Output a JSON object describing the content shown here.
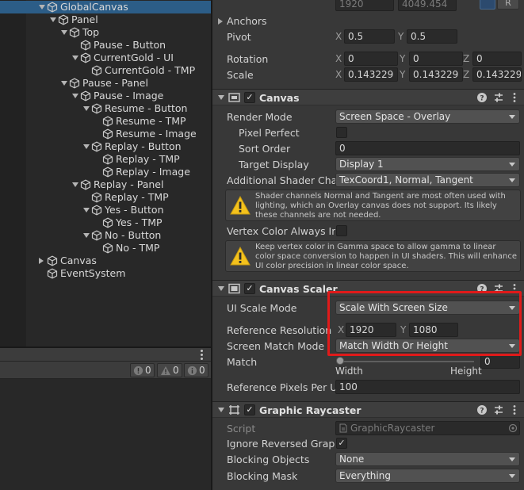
{
  "hierarchy": {
    "items": [
      {
        "label": "GlobalCanvas",
        "depth": 0,
        "expanded": true,
        "selected": true
      },
      {
        "label": "Panel",
        "depth": 1,
        "expanded": true
      },
      {
        "label": "Top",
        "depth": 2,
        "expanded": true
      },
      {
        "label": "Pause - Button",
        "depth": 3
      },
      {
        "label": "CurrentGold - UI",
        "depth": 3,
        "expanded": true
      },
      {
        "label": "CurrentGold - TMP",
        "depth": 4
      },
      {
        "label": "Pause - Panel",
        "depth": 2,
        "expanded": true
      },
      {
        "label": "Pause - Image",
        "depth": 3,
        "expanded": true
      },
      {
        "label": "Resume - Button",
        "depth": 4,
        "expanded": true
      },
      {
        "label": "Resume - TMP",
        "depth": 5
      },
      {
        "label": "Resume - Image",
        "depth": 5
      },
      {
        "label": "Replay - Button",
        "depth": 4,
        "expanded": true
      },
      {
        "label": "Replay - TMP",
        "depth": 5
      },
      {
        "label": "Replay - Image",
        "depth": 5
      },
      {
        "label": "Replay - Panel",
        "depth": 3,
        "expanded": true
      },
      {
        "label": "Replay - TMP",
        "depth": 4
      },
      {
        "label": "Yes - Button",
        "depth": 4,
        "expanded": true
      },
      {
        "label": "Yes - TMP",
        "depth": 5
      },
      {
        "label": "No - Button",
        "depth": 4,
        "expanded": true
      },
      {
        "label": "No - TMP",
        "depth": 5
      },
      {
        "label": "Canvas",
        "depth": 0,
        "expanded": false
      },
      {
        "label": "EventSystem",
        "depth": 0
      }
    ]
  },
  "console": {
    "errors": "0",
    "warnings": "0",
    "logs": "0"
  },
  "rect_transform": {
    "top_values": [
      "1920",
      "4049.454"
    ],
    "raw_edit_label": "R",
    "anchors_label": "Anchors",
    "pivot_label": "Pivot",
    "pivot_x": "0.5",
    "pivot_y": "0.5",
    "rotation_label": "Rotation",
    "rotation_x": "0",
    "rotation_y": "0",
    "rotation_z": "0",
    "scale_label": "Scale",
    "scale_x": "0.143229",
    "scale_y": "0.143229",
    "scale_z": "0.143229",
    "axis_x": "X",
    "axis_y": "Y",
    "axis_z": "Z"
  },
  "canvas": {
    "title": "Canvas",
    "render_mode_label": "Render Mode",
    "render_mode_value": "Screen Space - Overlay",
    "pixel_perfect_label": "Pixel Perfect",
    "sort_order_label": "Sort Order",
    "sort_order_value": "0",
    "target_display_label": "Target Display",
    "target_display_value": "Display 1",
    "shader_channels_label": "Additional Shader Chann",
    "shader_channels_value": "TexCoord1, Normal, Tangent",
    "shader_warning": "Shader channels Normal and Tangent are most often used with lighting, which an Overlay canvas does not support. Its likely these channels are not needed.",
    "vertex_color_label": "Vertex Color Always In G",
    "vertex_warning": "Keep vertex color in Gamma space to allow gamma to linear color space conversion to happen in UI shaders. This will enhance UI color precision in linear color space."
  },
  "canvas_scaler": {
    "title": "Canvas Scaler",
    "ui_scale_mode_label": "UI Scale Mode",
    "ui_scale_mode_value": "Scale With Screen Size",
    "reference_resolution_label": "Reference Resolution",
    "ref_x": "1920",
    "ref_y": "1080",
    "screen_match_mode_label": "Screen Match Mode",
    "screen_match_mode_value": "Match Width Or Height",
    "match_label": "Match",
    "match_value": "0",
    "match_fraction": 0,
    "width_label": "Width",
    "height_label": "Height",
    "ref_pixels_label": "Reference Pixels Per Un",
    "ref_pixels_value": "100"
  },
  "graphic_raycaster": {
    "title": "Graphic Raycaster",
    "script_label": "Script",
    "script_value": "GraphicRaycaster",
    "ignore_reversed_label": "Ignore Reversed Graphic",
    "blocking_objects_label": "Blocking Objects",
    "blocking_objects_value": "None",
    "blocking_mask_label": "Blocking Mask",
    "blocking_mask_value": "Everything"
  },
  "colors": {
    "selection": "#2c5d87",
    "highlight": "#e01a1a",
    "panel": "#383838",
    "field": "#2a2a2a"
  }
}
